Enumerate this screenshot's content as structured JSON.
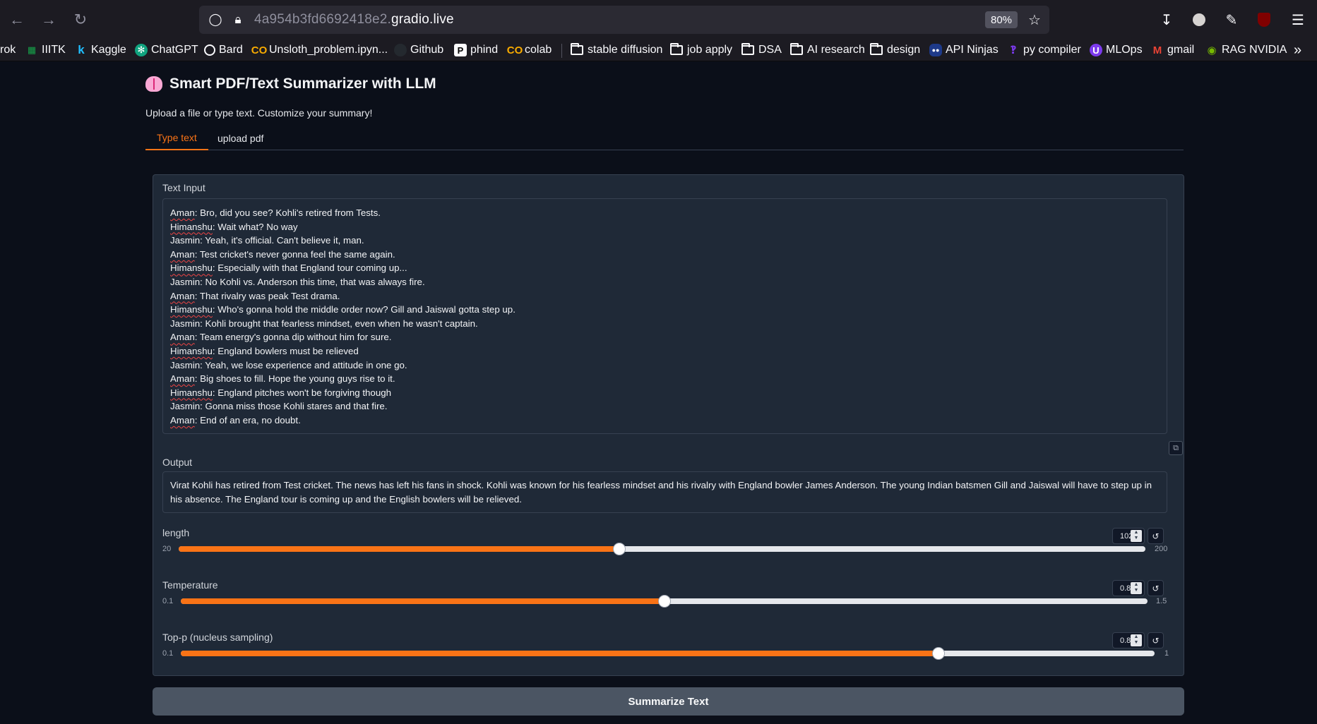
{
  "browser": {
    "url_host": "4a954b3fd6692418e2.",
    "url_domain": "gradio.live",
    "zoom": "80%",
    "bookmarks": [
      {
        "label": "rok",
        "icon": "grok-icon"
      },
      {
        "label": "IIITK",
        "icon": "iiitk-icon"
      },
      {
        "label": "Kaggle",
        "icon": "kaggle-icon"
      },
      {
        "label": "ChatGPT",
        "icon": "chatgpt-icon"
      },
      {
        "label": "Bard",
        "icon": "globe-icon"
      },
      {
        "label": "Unsloth_problem.ipyn...",
        "icon": "colab-icon"
      },
      {
        "label": "Github",
        "icon": "github-icon"
      },
      {
        "label": "phind",
        "icon": "phind-icon"
      },
      {
        "label": "colab",
        "icon": "colab-icon"
      },
      {
        "label": "stable diffusion",
        "icon": "folder-icon"
      },
      {
        "label": "job apply",
        "icon": "folder-icon"
      },
      {
        "label": "DSA",
        "icon": "folder-icon"
      },
      {
        "label": "AI research",
        "icon": "folder-icon"
      },
      {
        "label": "design",
        "icon": "folder-icon"
      },
      {
        "label": "API Ninjas",
        "icon": "api-ninjas-icon"
      },
      {
        "label": "py compiler",
        "icon": "py-compiler-icon"
      },
      {
        "label": "MLOps",
        "icon": "mlops-icon"
      },
      {
        "label": "gmail",
        "icon": "gmail-icon"
      },
      {
        "label": "RAG NVIDIA",
        "icon": "nvidia-icon"
      }
    ]
  },
  "app": {
    "title": "Smart PDF/Text Summarizer with LLM",
    "description": "Upload a file or type text. Customize your summary!",
    "tabs": [
      "Type text",
      "upload pdf"
    ],
    "text_input_label": "Text Input",
    "conversation": [
      {
        "speaker": "Aman",
        "text": ": Bro, did you see? Kohli's retired from Tests."
      },
      {
        "speaker": "Himanshu",
        "text": ": Wait what? No way"
      },
      {
        "speaker": "Jasmin",
        "text": ": Yeah, it's official. Can't believe it, man."
      },
      {
        "speaker": "Aman",
        "text": ": Test cricket's never gonna feel the same again."
      },
      {
        "speaker": "Himanshu",
        "text": ": Especially with that England tour coming up..."
      },
      {
        "speaker": "Jasmin",
        "text": ": No Kohli vs. Anderson this time, that was always fire."
      },
      {
        "speaker": "Aman",
        "text": ": That rivalry was peak Test drama."
      },
      {
        "speaker": "Himanshu",
        "text": ": Who's gonna hold the middle order now? Gill and Jaiswal gotta step up."
      },
      {
        "speaker": "Jasmin",
        "text": ": Kohli brought that fearless mindset, even when he wasn't captain."
      },
      {
        "speaker": "Aman",
        "text": ": Team energy's gonna dip without him for sure."
      },
      {
        "speaker": "Himanshu",
        "text": ": England bowlers must be relieved"
      },
      {
        "speaker": "Jasmin",
        "text": ": Yeah, we lose experience and attitude in one go."
      },
      {
        "speaker": "Aman",
        "text": ": Big shoes to fill. Hope the young guys rise to it."
      },
      {
        "speaker": "Himanshu",
        "text": ": England pitches won't be forgiving though"
      },
      {
        "speaker": "Jasmin",
        "text": ": Gonna miss those Kohli stares and that fire."
      },
      {
        "speaker": "Aman",
        "text": ": End of an era, no doubt."
      }
    ],
    "output_label": "Output",
    "output_text": "Virat Kohli has retired from Test cricket. The news has left his fans in shock. Kohli was known for his fearless mindset and his rivalry with England bowler James Anderson. The young Indian batsmen Gill and Jaiswal will have to step up in his absence. The England tour is coming up and the English bowlers will be relieved.",
    "sliders": [
      {
        "label": "length",
        "value": "102",
        "min": "20",
        "max": "200",
        "fraction": 0.456
      },
      {
        "label": "Temperature",
        "value": "0.8",
        "min": "0.1",
        "max": "1.5",
        "fraction": 0.5
      },
      {
        "label": "Top-p (nucleus sampling)",
        "value": "0.8",
        "min": "0.1",
        "max": "1",
        "fraction": 0.778
      }
    ],
    "submit_label": "Summarize Text"
  },
  "colors": {
    "accent": "#f97316",
    "background": "#0b0f19",
    "panel": "#1f2937"
  }
}
